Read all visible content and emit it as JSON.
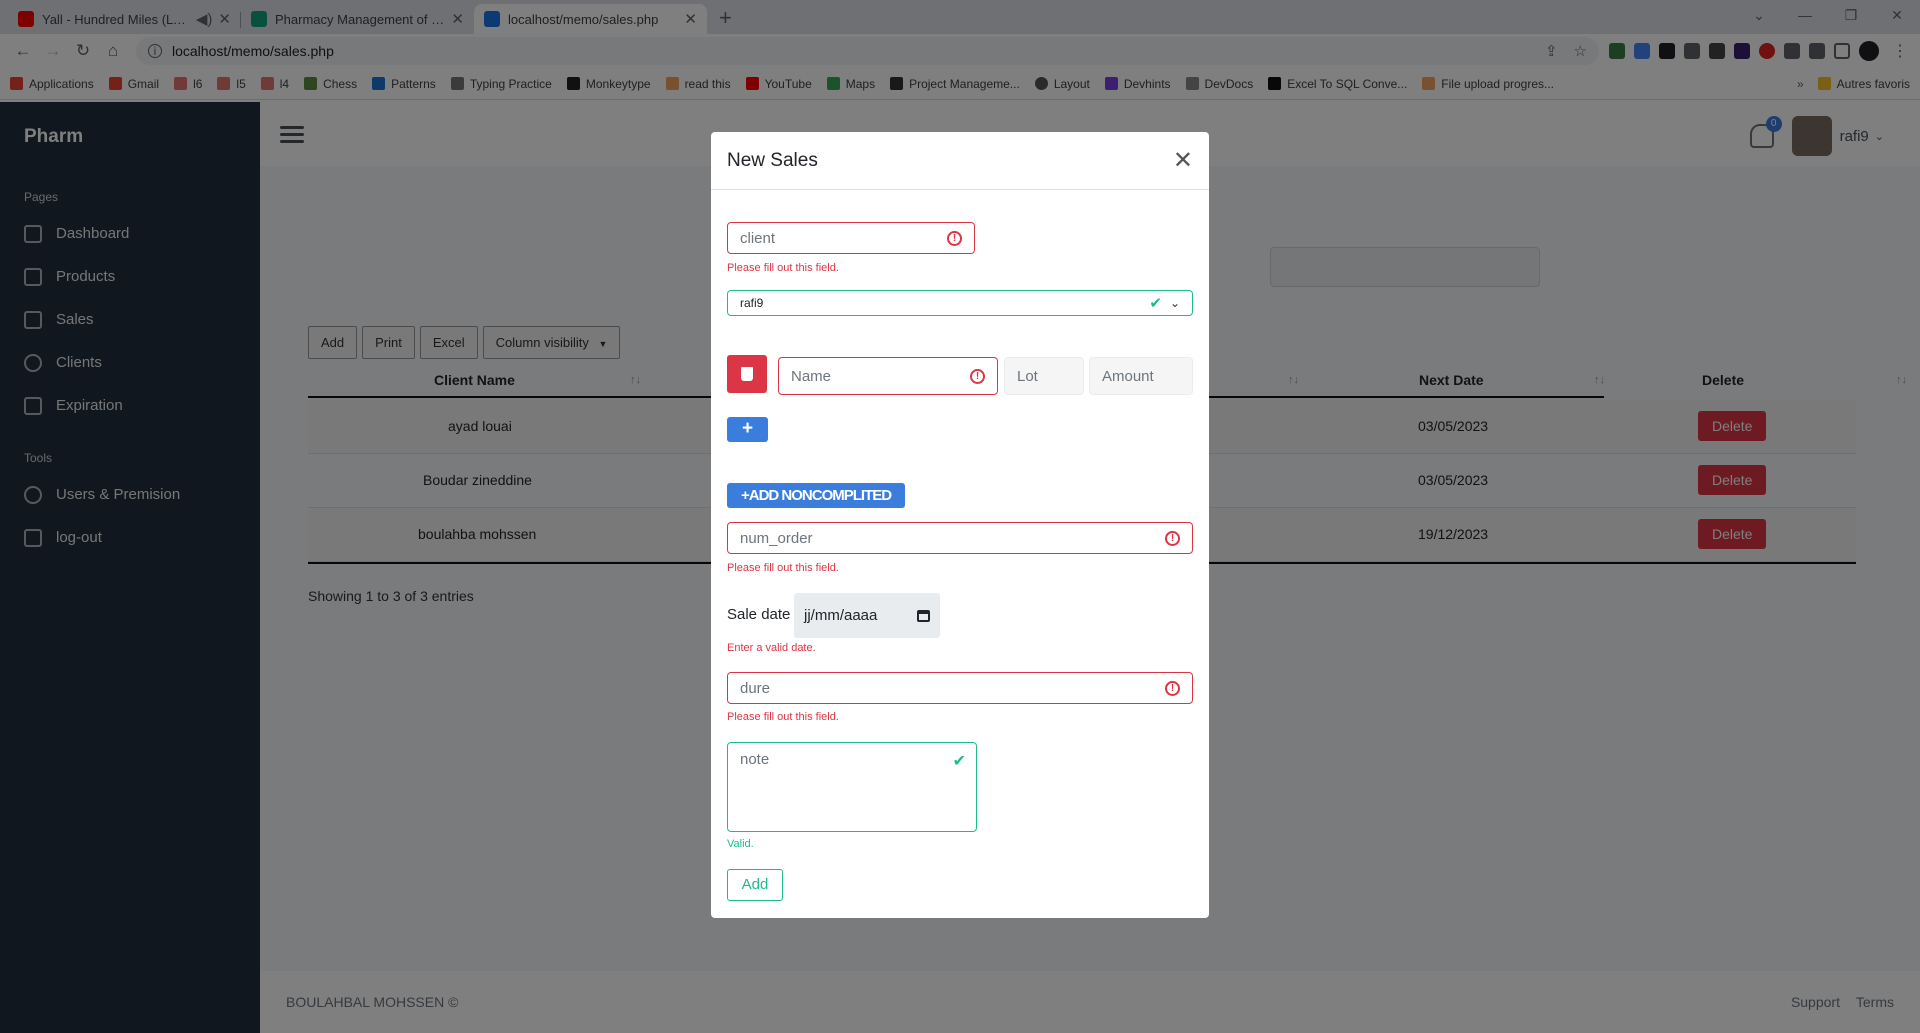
{
  "browser": {
    "tabs": [
      {
        "title": "Yall - Hundred Miles (Lyrics)",
        "favicon_color": "#ff0000"
      },
      {
        "title": "Pharmacy Management of Psych",
        "favicon_color": "#10a37f"
      },
      {
        "title": "localhost/memo/sales.php",
        "favicon_color": "#1a73e8"
      }
    ],
    "url": "localhost/memo/sales.php",
    "bookmarks": [
      "Applications",
      "Gmail",
      "l6",
      "l5",
      "l4",
      "Chess",
      "Patterns",
      "Typing Practice",
      "Monkeytype",
      "read this",
      "YouTube",
      "Maps",
      "Project Manageme...",
      "Layout",
      "Devhints",
      "DevDocs",
      "Excel To SQL Conve...",
      "File upload progres..."
    ],
    "bookmark_more": "»",
    "other_bookmarks": "Autres favoris"
  },
  "sidebar": {
    "brand": "Pharm",
    "section_pages": "Pages",
    "pages": [
      {
        "label": "Dashboard",
        "icon": "sliders-icon"
      },
      {
        "label": "Products",
        "icon": "box-icon"
      },
      {
        "label": "Sales",
        "icon": "cart-icon"
      },
      {
        "label": "Clients",
        "icon": "users-icon"
      },
      {
        "label": "Expiration",
        "icon": "clipboard-icon"
      }
    ],
    "section_tools": "Tools",
    "tools": [
      {
        "label": "Users & Premision",
        "icon": "gear-icon"
      },
      {
        "label": "log-out",
        "icon": "logout-icon"
      }
    ]
  },
  "topbar": {
    "notifications": "0",
    "username": "rafi9"
  },
  "table": {
    "buttons": [
      "Add",
      "Print",
      "Excel",
      "Column visibility"
    ],
    "dropdown_arrow": "▼",
    "columns": {
      "client": "Client Name",
      "next": "Next Date",
      "delete": "Delete"
    },
    "rows": [
      {
        "client": "ayad louai",
        "next": "03/05/2023",
        "action": "Delete"
      },
      {
        "client": "Boudar zineddine",
        "next": "03/05/2023",
        "action": "Delete"
      },
      {
        "client": "boulahba mohssen",
        "next": "19/12/2023",
        "action": "Delete"
      }
    ],
    "info": "Showing 1 to 3 of 3 entries"
  },
  "footer": {
    "copyright": "BOULAHBAL MOHSSEN ©",
    "links": [
      "Support",
      "Terms"
    ]
  },
  "modal": {
    "title": "New Sales",
    "client_placeholder": "client",
    "client_error": "Please fill out this field.",
    "user_select": "rafi9",
    "name_placeholder": "Name",
    "lot_placeholder": "Lot",
    "amount_placeholder": "Amount",
    "plus_label": "+",
    "add_noncompleted": "+ADD NONCOMPLITED",
    "num_order_placeholder": "num_order",
    "num_order_error": "Please fill out this field.",
    "sale_date_label": "Sale date",
    "sale_date_value": "jj/mm/aaaa",
    "sale_date_error": "Enter a valid date.",
    "dure_placeholder": "dure",
    "dure_error": "Please fill out this field.",
    "note_placeholder": "note",
    "note_valid": "Valid.",
    "submit": "Add"
  }
}
